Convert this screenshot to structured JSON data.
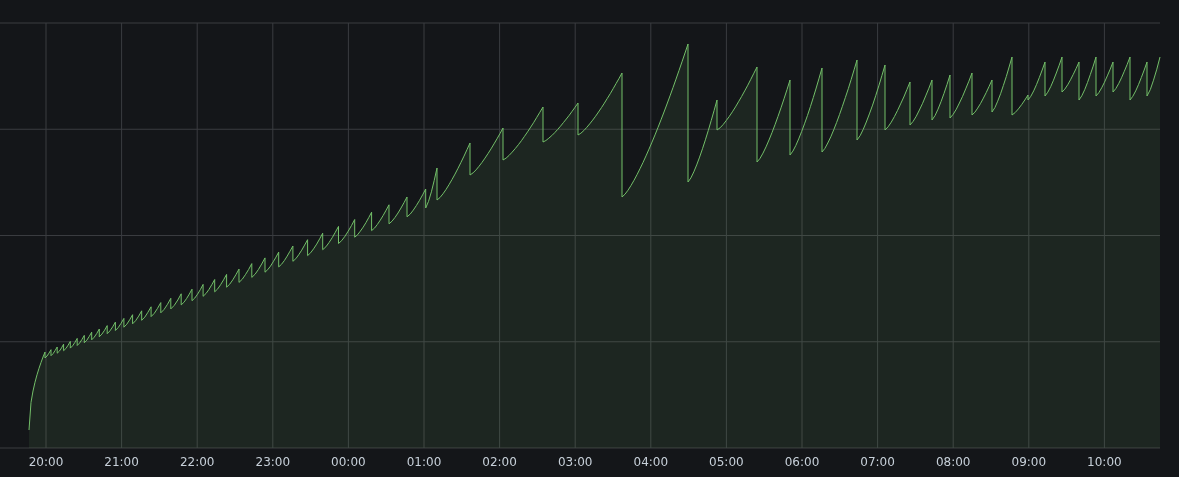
{
  "chart": {
    "x_axis_labels": [
      "20:00",
      "21:00",
      "22:00",
      "23:00",
      "00:00",
      "01:00",
      "02:00",
      "03:00",
      "04:00",
      "05:00",
      "06:00",
      "07:00",
      "08:00",
      "09:00",
      "10:00"
    ]
  }
}
